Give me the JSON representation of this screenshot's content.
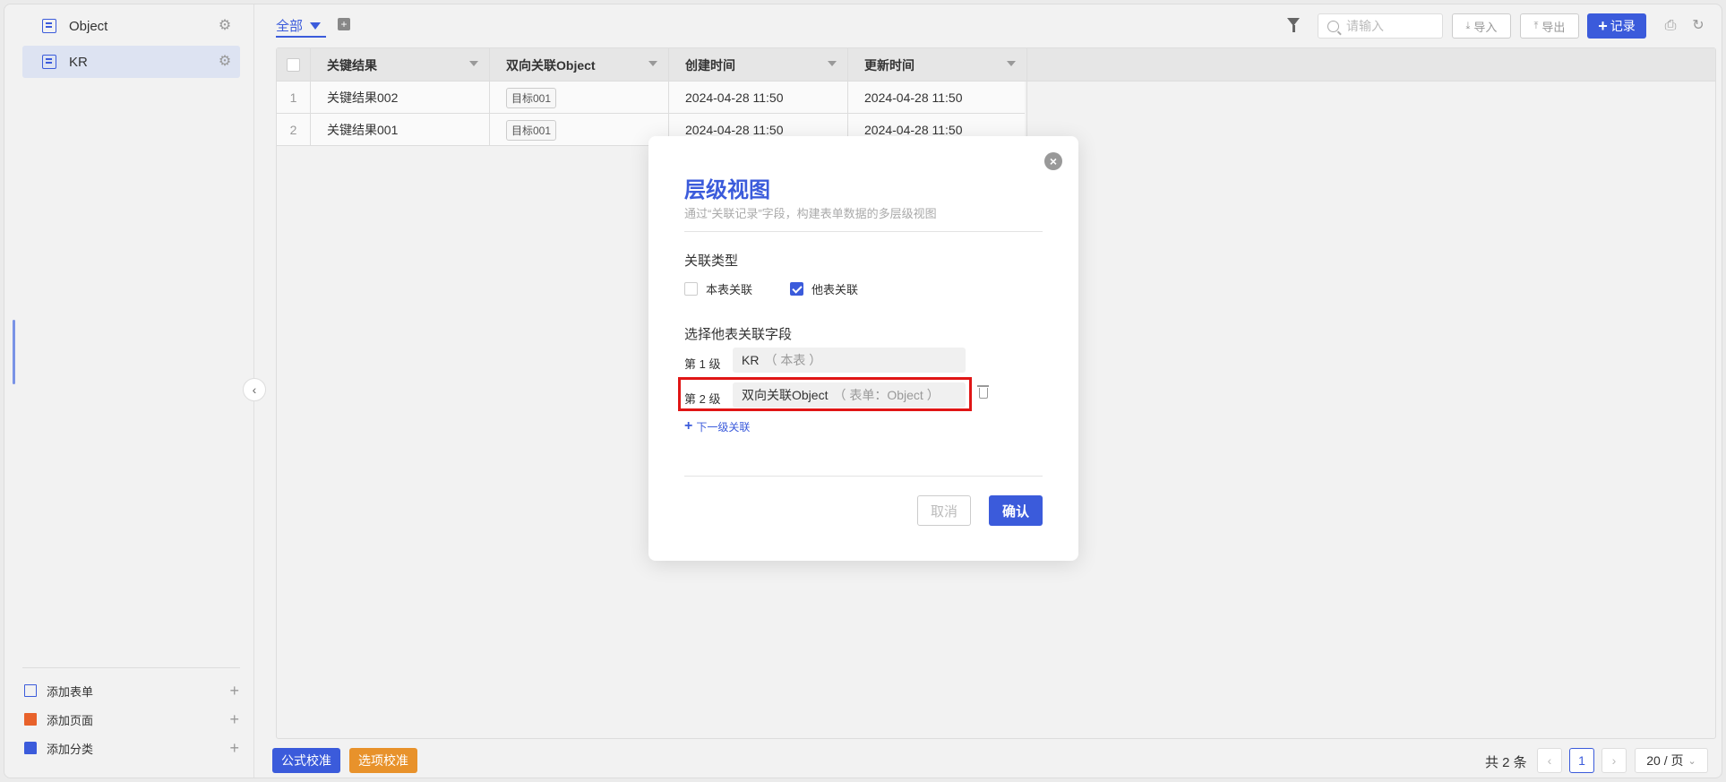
{
  "sidebar": {
    "items": [
      {
        "label": "Object"
      },
      {
        "label": "KR"
      }
    ],
    "footer": [
      {
        "label": "添加表单"
      },
      {
        "label": "添加页面"
      },
      {
        "label": "添加分类"
      }
    ]
  },
  "toolbar": {
    "tab_all": "全部",
    "search_placeholder": "请输入",
    "import_label": "导入",
    "export_label": "导出",
    "record_label": "记录"
  },
  "table": {
    "headers": [
      "关键结果",
      "双向关联Object",
      "创建时间",
      "更新时间"
    ],
    "rows": [
      {
        "num": "1",
        "kr": "关键结果002",
        "obj": "目标001",
        "created": "2024-04-28 11:50",
        "updated": "2024-04-28 11:50"
      },
      {
        "num": "2",
        "kr": "关键结果001",
        "obj": "目标001",
        "created": "2024-04-28 11:50",
        "updated": "2024-04-28 11:50"
      }
    ]
  },
  "footer": {
    "formula_btn": "公式校准",
    "option_btn": "选项校准",
    "total": "共 2 条",
    "current_page": "1",
    "page_size": "20 / 页"
  },
  "modal": {
    "title": "层级视图",
    "subtitle": "通过“关联记录”字段，构建表单数据的多层级视图",
    "relation_type_label": "关联类型",
    "option_self": "本表关联",
    "option_other": "他表关联",
    "option_self_checked": false,
    "option_other_checked": true,
    "select_field_label": "选择他表关联字段",
    "levels": [
      {
        "label": "第 1 级",
        "value": "KR",
        "note": "（ 本表 ）"
      },
      {
        "label": "第 2 级",
        "value": "双向关联Object",
        "note": "（ 表单：Object ）"
      }
    ],
    "next_level": "下一级关联",
    "cancel": "取消",
    "confirm": "确认"
  },
  "colors": {
    "accent": "#3b5bdb",
    "orange": "#e8922b",
    "highlight": "#e01515"
  }
}
